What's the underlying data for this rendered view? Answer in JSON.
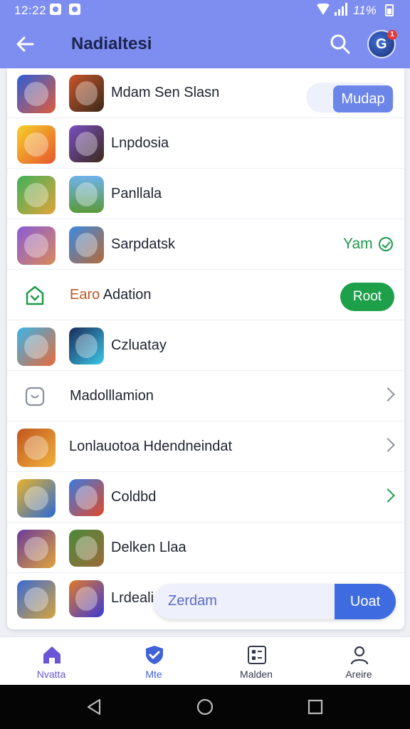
{
  "status_bar": {
    "time": "12:22",
    "battery": "11%"
  },
  "app_bar": {
    "title": "Nadialtesi",
    "notification_count": "1"
  },
  "rows": [
    {
      "label": "Mdam Sen Slasn",
      "toggle_label": "Mudap"
    },
    {
      "label": "Lnpdosia"
    },
    {
      "label": "Panllala"
    },
    {
      "label": "Sarpdatsk",
      "status": "Yam"
    },
    {
      "label_prefix": "Earo",
      "label": "Adation",
      "button": "Root"
    },
    {
      "label": "Czluatay"
    },
    {
      "label": "Madolllamion"
    },
    {
      "label": "Lonlauotoa Hdendneindat"
    },
    {
      "label": "Coldbd"
    },
    {
      "label": "Delken Llaa"
    },
    {
      "label": "Lrdeali"
    }
  ],
  "search": {
    "value": "Zerdam",
    "button": "Uoat"
  },
  "tabs": [
    {
      "label": "Nvatta"
    },
    {
      "label": "Mte"
    },
    {
      "label": "Malden"
    },
    {
      "label": "Areire"
    }
  ],
  "colors": {
    "header": "#7e8ef0",
    "accent": "#6b86e8",
    "success": "#1ea04a",
    "tab_active": "#6a56d6"
  }
}
